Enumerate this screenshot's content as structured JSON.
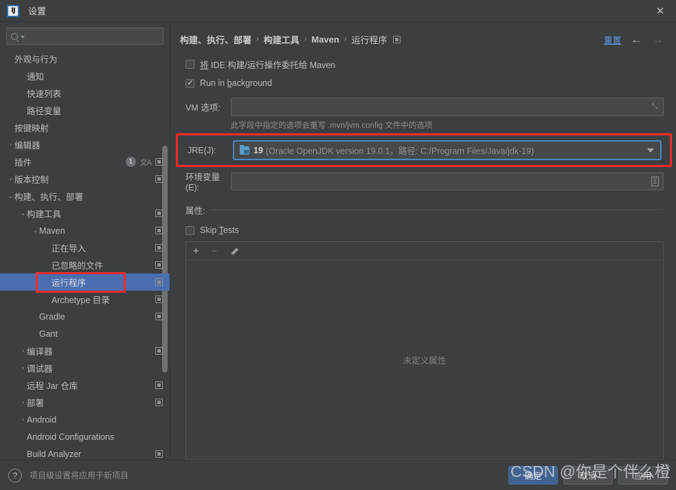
{
  "window": {
    "title": "设置",
    "logo_text": "IJ",
    "close_icon": "✕"
  },
  "sidebar": {
    "search": {
      "value": "",
      "placeholder": ""
    },
    "items": [
      {
        "label": "外观与行为",
        "indent": 0,
        "arrow": "",
        "badge": "",
        "translate": false,
        "square": false
      },
      {
        "label": "通知",
        "indent": 1,
        "arrow": "",
        "badge": "",
        "translate": false,
        "square": false
      },
      {
        "label": "快速列表",
        "indent": 1,
        "arrow": "",
        "badge": "",
        "translate": false,
        "square": false
      },
      {
        "label": "路径变量",
        "indent": 1,
        "arrow": "",
        "badge": "",
        "translate": false,
        "square": false
      },
      {
        "label": "按键映射",
        "indent": 0,
        "arrow": "",
        "badge": "",
        "translate": false,
        "square": false
      },
      {
        "label": "编辑器",
        "indent": 0,
        "arrow": "›",
        "badge": "",
        "translate": false,
        "square": false
      },
      {
        "label": "插件",
        "indent": 0,
        "arrow": "",
        "badge": "1",
        "translate": true,
        "square": true
      },
      {
        "label": "版本控制",
        "indent": 0,
        "arrow": "›",
        "badge": "",
        "translate": false,
        "square": true
      },
      {
        "label": "构建、执行、部署",
        "indent": 0,
        "arrow": "⌄",
        "badge": "",
        "translate": false,
        "square": false
      },
      {
        "label": "构建工具",
        "indent": 1,
        "arrow": "⌄",
        "badge": "",
        "translate": false,
        "square": true
      },
      {
        "label": "Maven",
        "indent": 2,
        "arrow": "⌄",
        "badge": "",
        "translate": false,
        "square": true
      },
      {
        "label": "正在导入",
        "indent": 3,
        "arrow": "",
        "badge": "",
        "translate": false,
        "square": true
      },
      {
        "label": "已忽略的文件",
        "indent": 3,
        "arrow": "",
        "badge": "",
        "translate": false,
        "square": true
      },
      {
        "label": "运行程序",
        "indent": 3,
        "arrow": "",
        "badge": "",
        "translate": false,
        "square": true,
        "selected": true,
        "highlighted": true
      },
      {
        "label": "Archetype 目录",
        "indent": 3,
        "arrow": "",
        "badge": "",
        "translate": false,
        "square": true
      },
      {
        "label": "Gradle",
        "indent": 2,
        "arrow": "",
        "badge": "",
        "translate": false,
        "square": true
      },
      {
        "label": "Gant",
        "indent": 2,
        "arrow": "",
        "badge": "",
        "translate": false,
        "square": false
      },
      {
        "label": "编译器",
        "indent": 1,
        "arrow": "›",
        "badge": "",
        "translate": false,
        "square": true
      },
      {
        "label": "调试器",
        "indent": 1,
        "arrow": "›",
        "badge": "",
        "translate": false,
        "square": false
      },
      {
        "label": "远程 Jar 仓库",
        "indent": 1,
        "arrow": "",
        "badge": "",
        "translate": false,
        "square": true
      },
      {
        "label": "部署",
        "indent": 1,
        "arrow": "›",
        "badge": "",
        "translate": false,
        "square": true
      },
      {
        "label": "Android",
        "indent": 1,
        "arrow": "›",
        "badge": "",
        "translate": false,
        "square": false
      },
      {
        "label": "Android Configurations",
        "indent": 1,
        "arrow": "",
        "badge": "",
        "translate": false,
        "square": false
      },
      {
        "label": "Build Analyzer",
        "indent": 1,
        "arrow": "",
        "badge": "",
        "translate": false,
        "square": true
      }
    ]
  },
  "main": {
    "breadcrumb": [
      {
        "text": "构建、执行、部署",
        "bold": true
      },
      {
        "text": "构建工具",
        "bold": true
      },
      {
        "text": "Maven",
        "bold": true
      },
      {
        "text": "运行程序",
        "bold": false
      }
    ],
    "separator": "›",
    "reset_label": "重置",
    "back_arrow": "←",
    "forward_arrow": "→",
    "delegate_checkbox": {
      "checked": false,
      "prefix": "将",
      "label": " IDE 构建/运行操作委托给 Maven"
    },
    "background_checkbox": {
      "checked": true,
      "label_before": "Run in ",
      "label_mnemonic": "b",
      "label_after": "ackground"
    },
    "vm_options": {
      "label": "VM 选项:",
      "value": "",
      "hint": "此字段中指定的选项会重写 .mvn/jvm.config 文件中的选项"
    },
    "jre": {
      "label": "JRE(J):",
      "version": "19",
      "description": "(Oracle OpenJDK version 19.0.1，路径: C:/Program Files/Java/jdk-19)",
      "highlight_color": "#fc2a2a",
      "focus_color": "#4a88c7"
    },
    "env_vars": {
      "label": "环境变量(E):",
      "value": ""
    },
    "properties": {
      "group_label": "属性:",
      "skip_tests": {
        "checked": false,
        "label_before": "Skip ",
        "label_mnemonic": "T",
        "label_after": "ests"
      },
      "toolbar": {
        "add": "+",
        "remove": "−",
        "edit": "edit-pencil"
      },
      "empty_message": "未定义属性",
      "rows": []
    }
  },
  "footer": {
    "help_icon": "?",
    "note": "项目级设置将应用于新项目",
    "buttons": [
      {
        "label": "确定",
        "primary": true
      },
      {
        "label": "取消",
        "primary": false
      },
      {
        "label": "应用",
        "primary": false
      }
    ]
  },
  "watermark": {
    "text": "CSDN @你是个伴么橙"
  },
  "colors": {
    "background": "#3c3f41",
    "selection": "#4b6eaf",
    "accent_link": "#5a9ae6",
    "highlight_red": "#fc2a2a",
    "primary_button": "#42628f"
  }
}
